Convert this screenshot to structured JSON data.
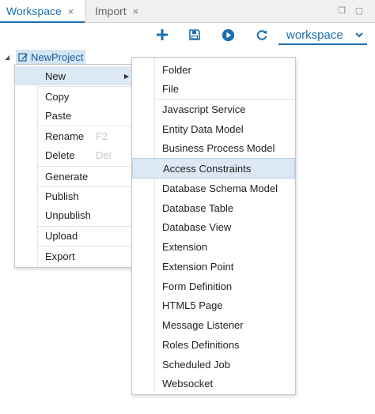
{
  "tabs": [
    {
      "label": "Workspace",
      "close": "×"
    },
    {
      "label": "Import",
      "close": "×"
    }
  ],
  "window_controls": {
    "restore_glyph": "❐",
    "maximize_glyph": "▢"
  },
  "toolbar": {
    "buttons": [
      {
        "icon": "plus-icon"
      },
      {
        "icon": "save-icon"
      },
      {
        "icon": "run-icon"
      },
      {
        "icon": "refresh-icon"
      }
    ],
    "workspace_select": {
      "value": "workspace"
    }
  },
  "tree": {
    "project": {
      "label": "NewProject",
      "icon": "edit-icon"
    }
  },
  "context_menu": {
    "items": [
      {
        "label": "New",
        "has_submenu": true,
        "highlighted": true
      },
      {
        "label": "Copy"
      },
      {
        "label": "Paste"
      },
      {
        "label": "Rename",
        "shortcut": "F2"
      },
      {
        "label": "Delete",
        "shortcut": "Del"
      },
      {
        "label": "Generate"
      },
      {
        "label": "Publish"
      },
      {
        "label": "Unpublish"
      },
      {
        "label": "Upload"
      },
      {
        "label": "Export"
      }
    ]
  },
  "submenu": {
    "items": [
      {
        "label": "Folder"
      },
      {
        "label": "File"
      },
      {
        "label": "Javascript Service"
      },
      {
        "label": "Entity Data Model"
      },
      {
        "label": "Business Process Model"
      },
      {
        "label": "Access Constraints",
        "highlighted": true
      },
      {
        "label": "Database Schema Model"
      },
      {
        "label": "Database Table"
      },
      {
        "label": "Database View"
      },
      {
        "label": "Extension"
      },
      {
        "label": "Extension Point"
      },
      {
        "label": "Form Definition"
      },
      {
        "label": "HTML5 Page"
      },
      {
        "label": "Message Listener"
      },
      {
        "label": "Roles Definitions"
      },
      {
        "label": "Scheduled Job"
      },
      {
        "label": "Websocket"
      }
    ]
  },
  "colors": {
    "accent": "#1b6fae",
    "selection": "#d3e6f5",
    "menu_highlight": "#dce8f4"
  }
}
